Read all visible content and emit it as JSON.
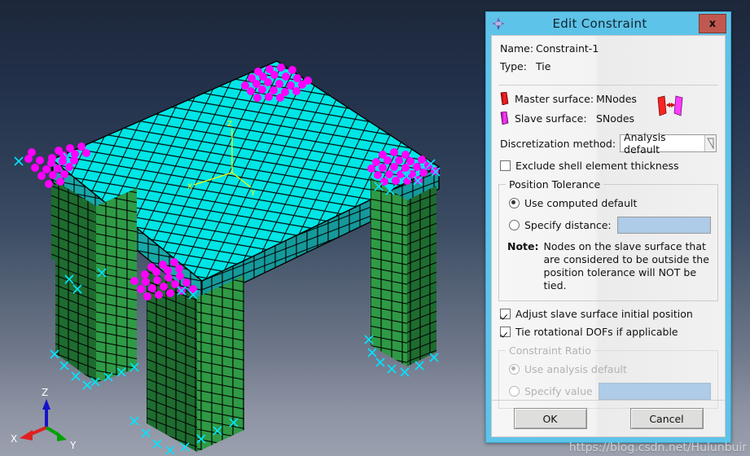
{
  "viewport": {
    "name": "abaqus-3d-viewport",
    "background_top": "#1d2739",
    "background_bottom": "#9aa0ae",
    "triad": {
      "x_label": "X",
      "y_label": "Y",
      "z_label": "Z",
      "x_color": "#e02020",
      "y_color": "#00a000",
      "z_color": "#1414c8"
    },
    "model_triad": {
      "x_label": "X",
      "y_label": "Y",
      "z_label": "Z",
      "color": "#ffff00"
    },
    "model": {
      "top_color": "#00e5e5",
      "top_side_color": "#19a5a5",
      "leg_color": "#2e9442",
      "leg_shade_color": "#1d6b2e",
      "mesh_line_color": "#000000",
      "tie_node_color": "#ff00ff",
      "bc_marker_color": "#00e5ff"
    }
  },
  "dialog": {
    "title": "Edit Constraint",
    "title_icon": "constraint-icon",
    "close_label": "x",
    "name_label": "Name:",
    "name_value": "Constraint-1",
    "type_label": "Type:",
    "type_value": "Tie",
    "master_label": "Master surface:",
    "master_value": "MNodes",
    "slave_label": "Slave surface:",
    "slave_value": "SNodes",
    "discretization_label": "Discretization method:",
    "discretization_value": "Analysis default",
    "exclude_shell_label": "Exclude shell element thickness",
    "exclude_shell_checked": false,
    "position_tolerance": {
      "legend": "Position Tolerance",
      "use_computed_label": "Use computed default",
      "use_computed_selected": true,
      "specify_distance_label": "Specify distance:",
      "specify_distance_selected": false,
      "specify_distance_value": "",
      "note_label": "Note:",
      "note_text": "Nodes on the slave surface that are considered to be outside the position tolerance will NOT be tied."
    },
    "adjust_slave_label": "Adjust slave surface initial position",
    "adjust_slave_checked": true,
    "tie_rotational_label": "Tie rotational DOFs if applicable",
    "tie_rotational_checked": true,
    "constraint_ratio": {
      "legend": "Constraint Ratio",
      "use_analysis_default_label": "Use analysis default",
      "use_analysis_default_selected": true,
      "specify_value_label": "Specify value",
      "specify_value_selected": false,
      "specify_value_value": "",
      "enabled": false
    },
    "ok_label": "OK",
    "cancel_label": "Cancel",
    "colors": {
      "titlebar": "#5ec3e8",
      "close_button": "#c1584f",
      "field_fill": "#aecbe8",
      "master_icon": "#ee1111",
      "slave_icon": "#ee22ee"
    }
  },
  "watermark": {
    "text": "https://blog.csdn.net/Hulunbuir"
  }
}
